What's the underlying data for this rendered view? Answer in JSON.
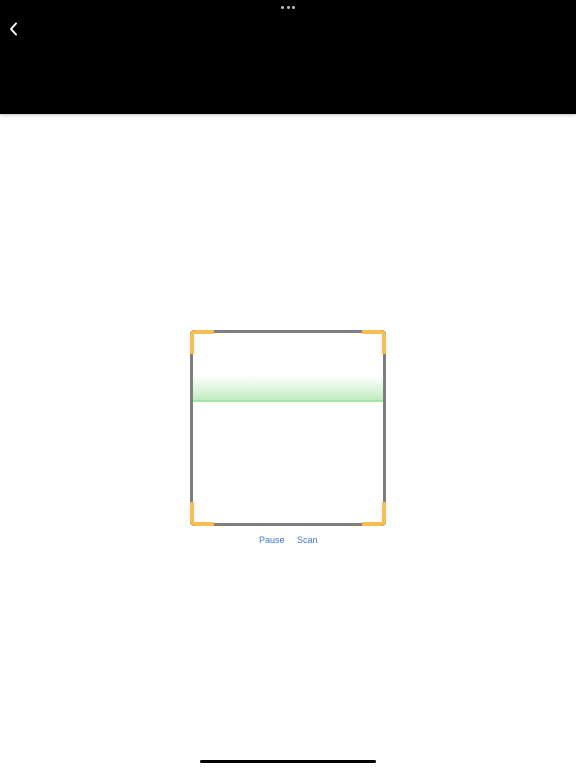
{
  "header": {
    "back_icon": "chevron-left-icon",
    "more_icon": "more-dots-icon"
  },
  "scanner": {
    "frame_color": "#7f7f7f",
    "corner_color": "#f6bd55",
    "scan_line_color": "#b8eab8"
  },
  "controls": {
    "pause_label": "Pause",
    "scan_label": "Scan",
    "link_color": "#3a78c8"
  }
}
